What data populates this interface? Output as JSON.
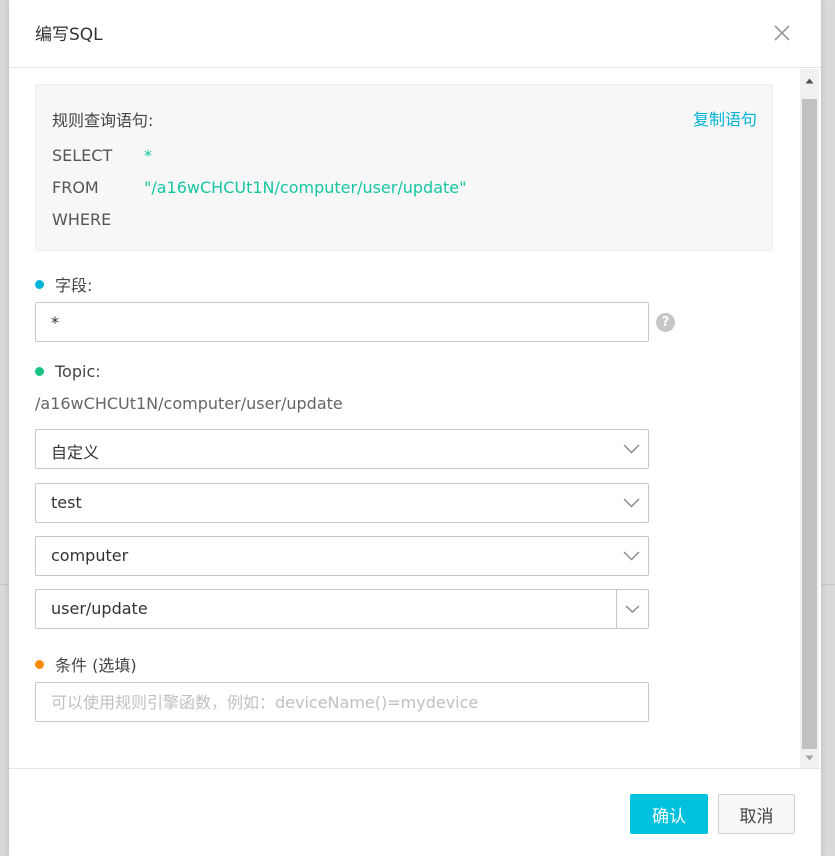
{
  "dialog": {
    "title": "编写SQL",
    "confirm_label": "确认",
    "cancel_label": "取消"
  },
  "sql_preview": {
    "title": "规则查询语句:",
    "copy_label": "复制语句",
    "select_kw": "SELECT",
    "select_value": "*",
    "from_kw": "FROM",
    "from_value": "\"/a16wCHCUt1N/computer/user/update\"",
    "where_kw": "WHERE"
  },
  "fields": {
    "label": "字段:",
    "value": "*",
    "help_symbol": "?"
  },
  "topic": {
    "label": "Topic:",
    "path": "/a16wCHCUt1N/computer/user/update",
    "selects": [
      "自定义",
      "test",
      "computer",
      "user/update"
    ]
  },
  "condition": {
    "label": "条件 (选填)",
    "placeholder": "可以使用规则引擎函数，例如：deviceName()=mydevice"
  },
  "colors": {
    "accent": "#00c1de",
    "sql_value": "#16c6a2",
    "dot_fields": "#00b4d8",
    "dot_topic": "#16c184",
    "dot_condition": "#ff8a00"
  },
  "icons": {
    "close": "close-icon",
    "chevron": "chevron-down-icon",
    "help": "help-icon"
  }
}
